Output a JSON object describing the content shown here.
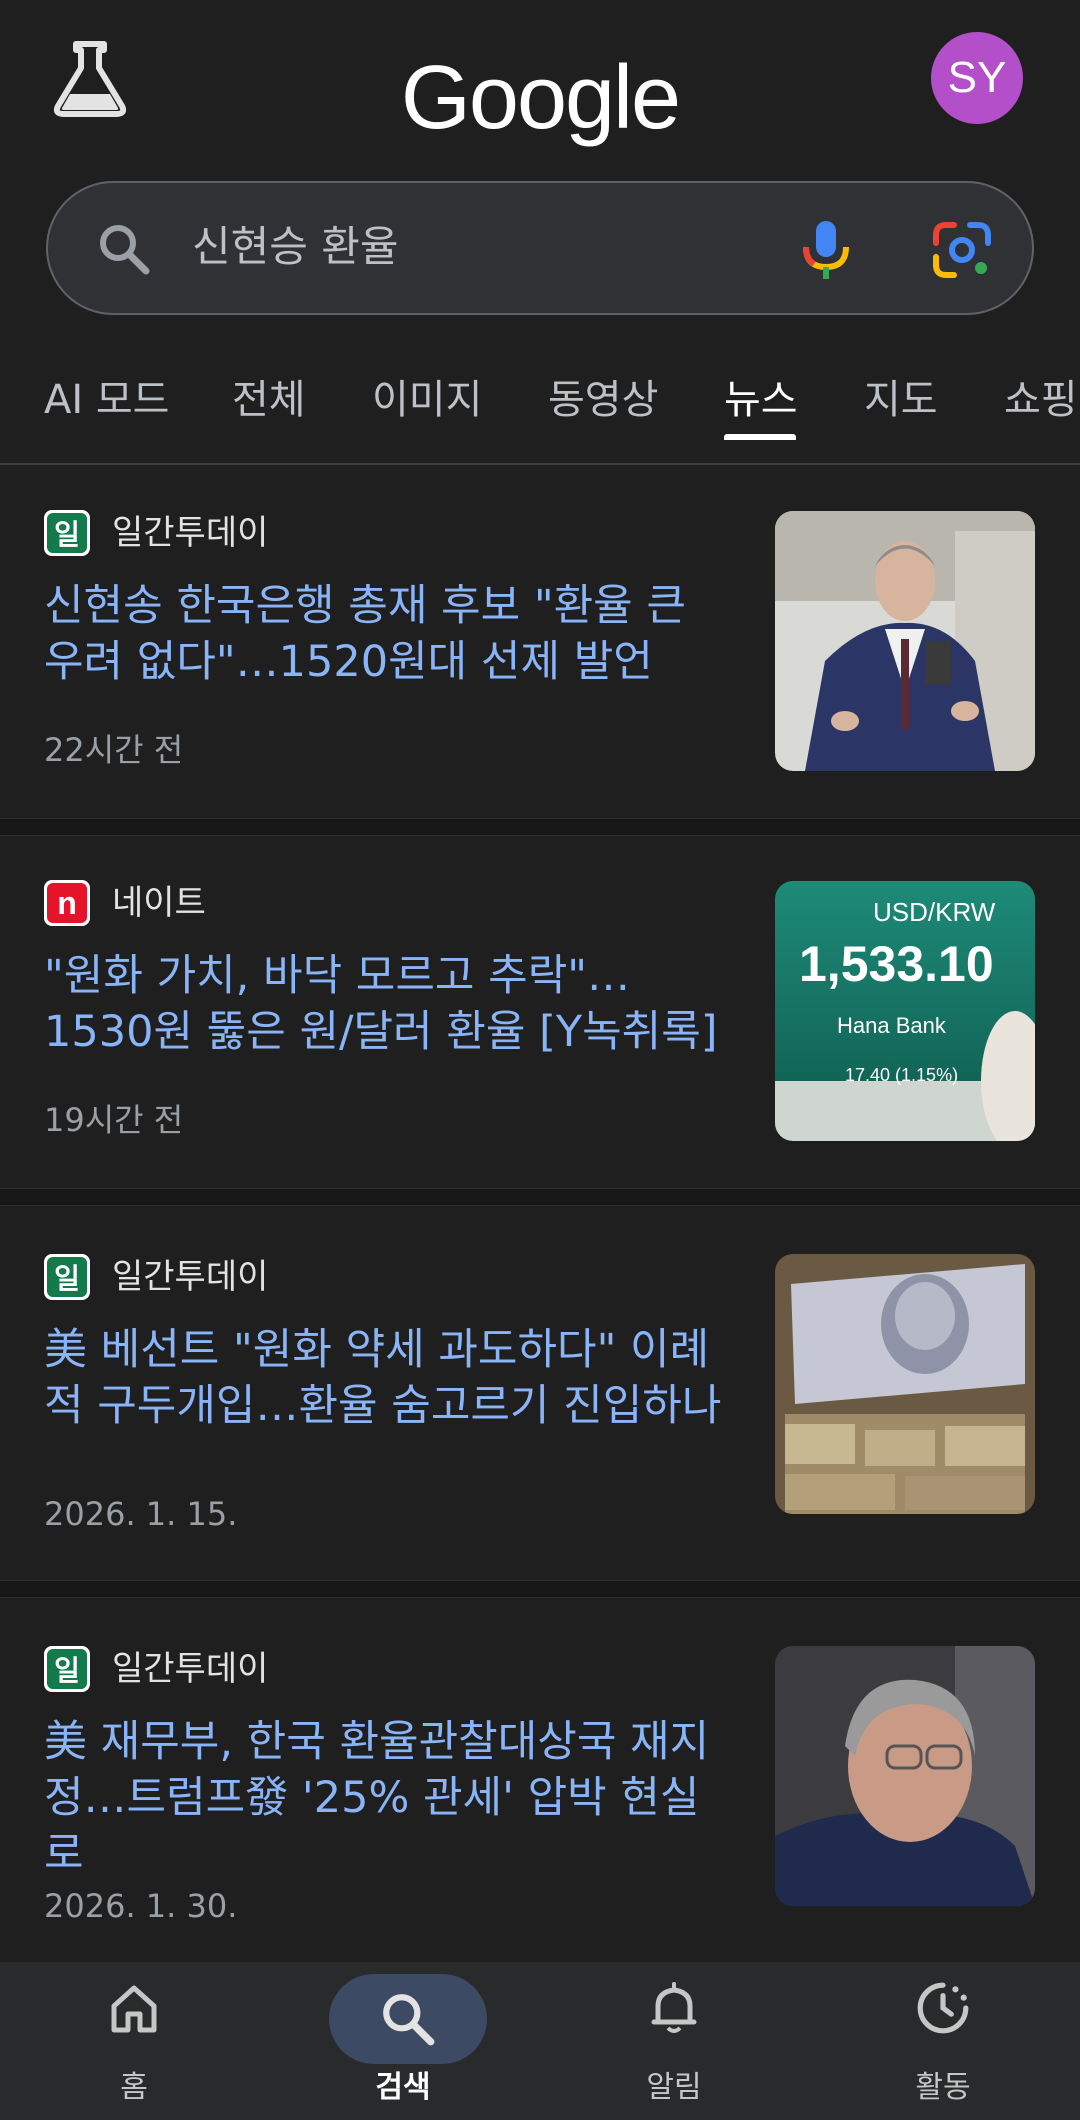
{
  "header": {
    "logo_text": "Google",
    "avatar_initials": "SY",
    "avatar_color": "#b34fc9"
  },
  "search": {
    "query": "신현승 환율"
  },
  "tabs": [
    {
      "label": "AI 모드"
    },
    {
      "label": "전체"
    },
    {
      "label": "이미지"
    },
    {
      "label": "동영상"
    },
    {
      "label": "뉴스",
      "active": true
    },
    {
      "label": "지도"
    },
    {
      "label": "쇼핑"
    }
  ],
  "news": [
    {
      "source": "일간투데이",
      "source_logo": "일",
      "headline": "신현송 한국은행 총재 후보 \"환율 큰 우려 없다\"…1520원대 선제 발언",
      "time": "22시간 전",
      "thumb": "man-in-suit-speaking-photo"
    },
    {
      "source": "네이트",
      "source_logo": "n",
      "headline": "\"원화 가치, 바닥 모르고 추락\"… 1530원 뚫은 원/달러 환율 [Y녹취록]",
      "time": "19시간 전",
      "thumb": "exchange-rate-board-photo",
      "thumb_text": {
        "pair": "USD/KRW",
        "rate": "1,533.10",
        "bank": "Hana Bank",
        "change": "17.40 (1.15%)"
      }
    },
    {
      "source": "일간투데이",
      "source_logo": "일",
      "headline": "美 베선트 \"원화 약세 과도하다\" 이례적 구두개입…환율 숨고르기 진입하나",
      "time": "2026. 1. 15.",
      "thumb": "dollar-bills-photo"
    },
    {
      "source": "일간투데이",
      "source_logo": "일",
      "headline": "美 재무부, 한국 환율관찰대상국 재지정…트럼프發 '25% 관세' 압박 현실로",
      "time": "2026. 1. 30.",
      "thumb": "man-with-glasses-photo"
    }
  ],
  "bottom_nav": [
    {
      "label": "홈",
      "icon": "home-icon"
    },
    {
      "label": "검색",
      "icon": "search-icon",
      "active": true
    },
    {
      "label": "알림",
      "icon": "bell-icon"
    },
    {
      "label": "활동",
      "icon": "activity-icon"
    }
  ]
}
